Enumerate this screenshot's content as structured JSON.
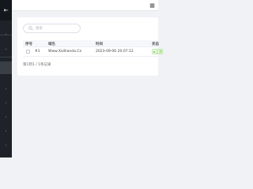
{
  "sidebar": {
    "toggle_icon": "collapse-sidebar-icon",
    "items": [
      {
        "icon": "chevron-left-icon"
      },
      {
        "icon": "chevron-down-icon"
      },
      {
        "icon": "chevron-left-icon"
      },
      {
        "icon": "chevron-left-icon"
      },
      {
        "icon": "chevron-left-icon"
      },
      {
        "icon": "chevron-left-icon"
      },
      {
        "icon": "chevron-left-icon"
      }
    ]
  },
  "topbar": {
    "fullscreen_icon": "fullscreen-icon"
  },
  "search": {
    "placeholder": "搜索"
  },
  "table": {
    "columns": [
      "序号",
      "域名",
      "时间",
      "状态"
    ],
    "rows": [
      {
        "index": "#1",
        "domain": "Www.Xaillianda.Cn",
        "time": "2023-09-06 20:07:12",
        "status": "正常"
      }
    ]
  },
  "pagination": {
    "summary": "第1到1 / 1条记录"
  },
  "colors": {
    "sidebar_bg": "#1f2329",
    "status_green": "#67c23a"
  }
}
